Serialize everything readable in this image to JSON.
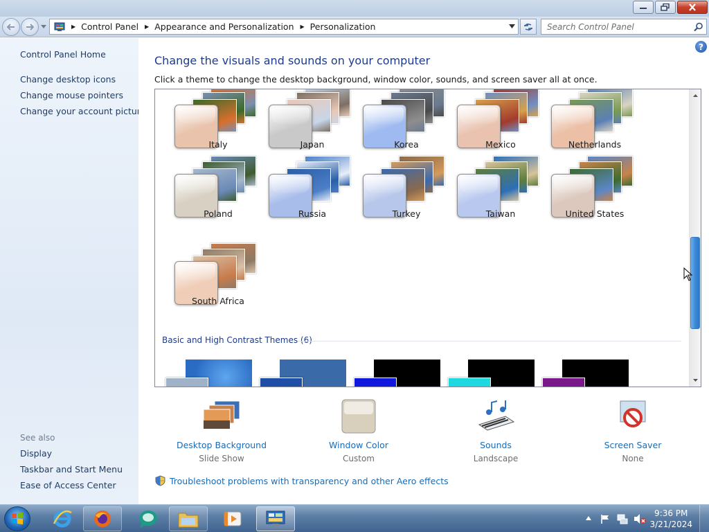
{
  "window": {
    "controls": [
      "minimize",
      "restore",
      "close"
    ]
  },
  "address": {
    "breadcrumbs": [
      "Control Panel",
      "Appearance and Personalization",
      "Personalization"
    ],
    "search_placeholder": "Search Control Panel"
  },
  "left_pane": {
    "home": "Control Panel Home",
    "links": [
      "Change desktop icons",
      "Change mouse pointers",
      "Change your account picture"
    ],
    "see_also_title": "See also",
    "see_also": [
      "Display",
      "Taskbar and Start Menu",
      "Ease of Access Center"
    ]
  },
  "main": {
    "title": "Change the visuals and sounds on your computer",
    "description": "Click a theme to change the desktop background, window color, sounds, and screen saver all at once.",
    "themes": [
      {
        "name": "Italy",
        "swatch": "#e9c3ab",
        "art": [
          "#d96f2c",
          "#7b8fb0",
          "#3c6a2a"
        ]
      },
      {
        "name": "Japan",
        "swatch": "#c9c9c9",
        "art": [
          "#c8d6e8",
          "#7d6f63",
          "#e9c9b8"
        ]
      },
      {
        "name": "Korea",
        "swatch": "#9fbaf0",
        "art": [
          "#8e8e8e",
          "#6b7a90",
          "#4a4a4a"
        ]
      },
      {
        "name": "Mexico",
        "swatch": "#eac3b0",
        "art": [
          "#a33b2c",
          "#6f8fc4",
          "#d7a04b"
        ]
      },
      {
        "name": "Netherlands",
        "swatch": "#ebc0a6",
        "art": [
          "#5b7fb5",
          "#d9d4c2",
          "#7a9a53"
        ]
      },
      {
        "name": "Poland",
        "swatch": "#d8d0c2",
        "art": [
          "#6b8ab7",
          "#3e5b2f",
          "#a7b8cc"
        ]
      },
      {
        "name": "Russia",
        "swatch": "#a9bdeb",
        "art": [
          "#4c7fc8",
          "#e7eef8",
          "#2c5fa8"
        ]
      },
      {
        "name": "Turkey",
        "swatch": "#b7c7ec",
        "art": [
          "#8a6a4d",
          "#d49a5a",
          "#3a6ab0"
        ]
      },
      {
        "name": "Taiwan",
        "swatch": "#b9c8ef",
        "art": [
          "#2d6fb8",
          "#d7c39a",
          "#5f7d3c"
        ]
      },
      {
        "name": "United States",
        "swatch": "#dcc8bd",
        "art": [
          "#5a86c6",
          "#c9834a",
          "#3d6b2f"
        ]
      },
      {
        "name": "South Africa",
        "swatch": "#f0cdb7",
        "art": [
          "#c87b4c",
          "#8d7a66",
          "#d9c1a8"
        ]
      }
    ],
    "basic_section_title": "Basic and High Contrast Themes (6)",
    "basic_themes": [
      {
        "bg": "#2a6cc4",
        "chip": "#9fb2c8"
      },
      {
        "bg": "#3a6aa7",
        "chip": "#1e4ea6"
      },
      {
        "bg": "#000000",
        "chip": "#1018e0"
      },
      {
        "bg": "#000000",
        "chip": "#1fd8e0"
      },
      {
        "bg": "#000000",
        "chip": "#7a1a8a"
      }
    ],
    "tools": [
      {
        "name": "Desktop Background",
        "value": "Slide Show",
        "icon": "desktop-background-icon"
      },
      {
        "name": "Window Color",
        "value": "Custom",
        "icon": "window-color-icon"
      },
      {
        "name": "Sounds",
        "value": "Landscape",
        "icon": "sounds-icon"
      },
      {
        "name": "Screen Saver",
        "value": "None",
        "icon": "screen-saver-icon"
      }
    ],
    "troubleshoot": "Troubleshoot problems with transparency and other Aero effects"
  },
  "taskbar": {
    "items": [
      "Internet Explorer",
      "Firefox",
      "Chat",
      "Windows Explorer",
      "Media Player",
      "Control Panel"
    ],
    "time": "9:36 PM",
    "date": "3/21/2024"
  }
}
